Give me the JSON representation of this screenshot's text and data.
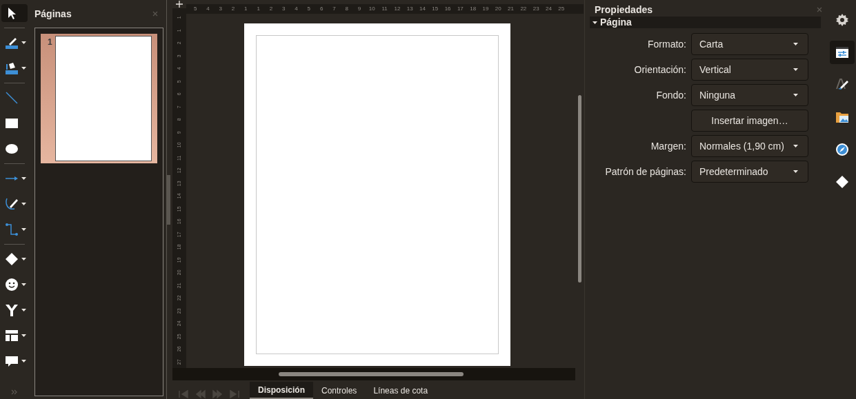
{
  "tool_groups": [
    [
      {
        "kind": "pointer",
        "selected": true,
        "dropdown": false
      }
    ],
    [
      {
        "kind": "line-color",
        "selected": false,
        "dropdown": true
      },
      {
        "kind": "fill-color",
        "selected": false,
        "dropdown": true
      }
    ],
    [
      {
        "kind": "line",
        "selected": false,
        "dropdown": false
      },
      {
        "kind": "rectangle",
        "selected": false,
        "dropdown": false
      },
      {
        "kind": "ellipse",
        "selected": false,
        "dropdown": false
      }
    ],
    [
      {
        "kind": "arrow",
        "selected": false,
        "dropdown": true
      },
      {
        "kind": "curve",
        "selected": false,
        "dropdown": true
      },
      {
        "kind": "connector",
        "selected": false,
        "dropdown": true
      }
    ],
    [
      {
        "kind": "diamond",
        "selected": false,
        "dropdown": true
      },
      {
        "kind": "smiley",
        "selected": false,
        "dropdown": true
      },
      {
        "kind": "y-shape",
        "selected": false,
        "dropdown": true
      },
      {
        "kind": "flowchart",
        "selected": false,
        "dropdown": true
      },
      {
        "kind": "callout",
        "selected": false,
        "dropdown": true
      }
    ]
  ],
  "pages_panel": {
    "title": "Páginas",
    "pages": [
      {
        "number": "1",
        "selected": true
      }
    ]
  },
  "ruler": {
    "horizontal": [
      "5",
      "4",
      "3",
      "2",
      "1",
      "1",
      "2",
      "3",
      "4",
      "5",
      "6",
      "7",
      "8",
      "9",
      "10",
      "11",
      "12",
      "13",
      "14",
      "15",
      "16",
      "17",
      "18",
      "19",
      "20",
      "21",
      "22",
      "23",
      "24",
      "25"
    ],
    "vertical": [
      "1",
      "1",
      "2",
      "3",
      "4",
      "5",
      "6",
      "7",
      "8",
      "9",
      "10",
      "11",
      "12",
      "13",
      "14",
      "15",
      "16",
      "17",
      "18",
      "19",
      "20",
      "21",
      "22",
      "23",
      "24",
      "25",
      "26",
      "27"
    ]
  },
  "bottom_tabs": [
    {
      "label": "Disposición",
      "selected": true
    },
    {
      "label": "Controles",
      "selected": false
    },
    {
      "label": "Líneas de cota",
      "selected": false
    }
  ],
  "properties": {
    "title": "Propiedades",
    "section": {
      "title": "Página",
      "expanded": true,
      "fields": [
        {
          "kind": "dropdown",
          "label": "Formato:",
          "value": "Carta"
        },
        {
          "kind": "dropdown",
          "label": "Orientación:",
          "value": "Vertical"
        },
        {
          "kind": "dropdown",
          "label": "Fondo:",
          "value": "Ninguna"
        },
        {
          "kind": "button",
          "value": "Insertar imagen…"
        },
        {
          "kind": "dropdown",
          "label": "Margen:",
          "value": "Normales (1,90 cm)"
        },
        {
          "kind": "dropdown",
          "label": "Patrón de páginas:",
          "value": "Predeterminado"
        }
      ]
    }
  },
  "sidebar_tabs": [
    {
      "kind": "settings",
      "selected": false
    },
    {
      "kind": "properties",
      "selected": true
    },
    {
      "kind": "styles",
      "selected": false
    },
    {
      "kind": "gallery",
      "selected": false
    },
    {
      "kind": "navigator",
      "selected": false
    },
    {
      "kind": "shapes",
      "selected": false
    }
  ]
}
